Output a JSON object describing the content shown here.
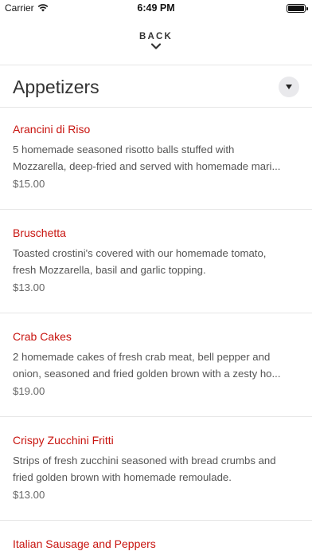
{
  "status_bar": {
    "carrier": "Carrier",
    "time": "6:49 PM"
  },
  "nav": {
    "back_label": "BACK"
  },
  "section": {
    "title": "Appetizers"
  },
  "items": [
    {
      "name": "Arancini di Riso",
      "desc_lines": [
        "5 homemade seasoned risotto balls stuffed with",
        "Mozzarella, deep-fried and served with homemade mari..."
      ],
      "price": "$15.00"
    },
    {
      "name": "Bruschetta",
      "desc_lines": [
        "Toasted crostini's covered with our homemade tomato,",
        "fresh Mozzarella, basil and garlic topping."
      ],
      "price": "$13.00"
    },
    {
      "name": "Crab Cakes",
      "desc_lines": [
        "2 homemade cakes of fresh crab meat, bell pepper and",
        "onion, seasoned and fried golden brown with a zesty ho..."
      ],
      "price": "$19.00"
    },
    {
      "name": "Crispy Zucchini Fritti",
      "desc_lines": [
        "Strips of fresh zucchini seasoned with bread crumbs and",
        "fried golden brown with homemade remoulade."
      ],
      "price": "$13.00"
    },
    {
      "name": "Italian Sausage and Peppers",
      "desc_lines": [],
      "price": ""
    }
  ],
  "colors": {
    "item_name": "#c8140f",
    "divider": "#e6e6e6",
    "toggle_bg": "#e9e9ec"
  },
  "icons": {
    "wifi": "wifi-icon",
    "battery": "battery-icon",
    "back_chevron": "chevron-down-icon",
    "section_toggle": "caret-down-icon"
  }
}
